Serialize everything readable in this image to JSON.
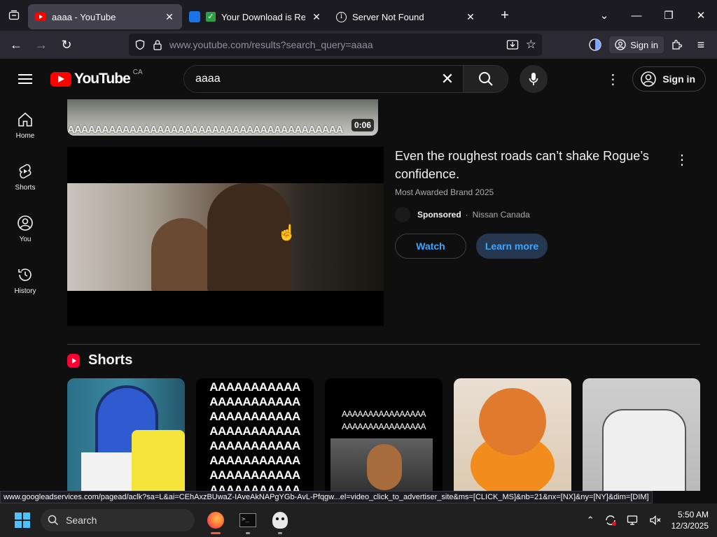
{
  "browser": {
    "tabs": [
      {
        "title": "aaaa - YouTube",
        "active": true,
        "icon": "youtube-favicon"
      },
      {
        "title": "Your Download is Ready",
        "active": false,
        "icon": "download-favicon"
      },
      {
        "title": "Server Not Found",
        "active": false,
        "icon": "info-icon"
      }
    ],
    "url_host": "www.youtube.com",
    "url_path": "/results?search_query=aaaa",
    "signin_label": "Sign in"
  },
  "youtube": {
    "country": "CA",
    "logo_text": "YouTube",
    "search_value": "aaaa",
    "signin_label": "Sign in",
    "sidebar": [
      {
        "label": "Home",
        "icon": "home-icon"
      },
      {
        "label": "Shorts",
        "icon": "shorts-icon"
      },
      {
        "label": "You",
        "icon": "user-icon"
      },
      {
        "label": "History",
        "icon": "history-icon"
      }
    ],
    "previous_video": {
      "duration": "0:06",
      "pattern_text": "AAAAAAAAAAAAAAAAAAAAAAAAAAAAAAAAAAAAAAAA"
    },
    "ad": {
      "title": "Even the roughest roads can’t shake Rogue’s confidence.",
      "subtitle": "Most Awarded Brand 2025",
      "sponsored_label": "Sponsored",
      "separator": "·",
      "advertiser": "Nissan Canada",
      "watch_label": "Watch",
      "learn_more_label": "Learn more"
    },
    "shorts_heading": "Shorts",
    "shorts": [
      {
        "text": ""
      },
      {
        "text": "AAAAAAAAAAA AAAAAAAAAAA AAAAAAAAAAA AAAAAAAAAAA AAAAAAAAAAA AAAAAAAAAAA AAAAAAAAAAA AAAAAAAAAAA"
      },
      {
        "text": "AAAAAAAAAAAAAAAA AAAAAAAAAAAAAAAA"
      },
      {
        "text": ""
      },
      {
        "text": ""
      }
    ]
  },
  "status_url": "www.googleadservices.com/pagead/aclk?sa=L&ai=CEhAxzBUwaZ-IAveAkNAPgYGb-AvL-Pfqgw...el=video_click_to_advertiser_site&ms=[CLICK_MS]&nb=21&nx=[NX]&ny=[NY]&dim=[DIM]",
  "taskbar": {
    "search_label": "Search",
    "time": "5:50 AM",
    "date": "12/3/2025"
  },
  "colors": {
    "accent": "#3ea6ff",
    "youtube_red": "#ff0000",
    "shorts_red": "#ff0033"
  }
}
